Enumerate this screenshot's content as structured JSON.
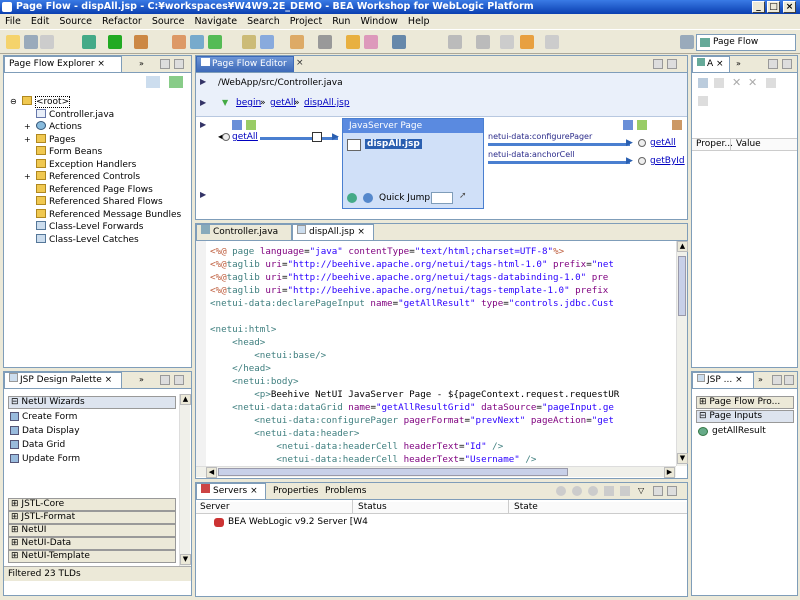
{
  "window": {
    "title": "Page Flow - dispAll.jsp - C:¥workspaces¥W4W9.2E_DEMO - BEA Workshop for WebLogic Platform",
    "min": "_",
    "max": "□",
    "close": "×"
  },
  "menu": [
    "File",
    "Edit",
    "Source",
    "Refactor",
    "Source",
    "Navigate",
    "Search",
    "Project",
    "Run",
    "Window",
    "Help"
  ],
  "perspective": {
    "label": "Page Flow"
  },
  "explorer": {
    "tab": "Page Flow Explorer",
    "items": [
      {
        "label": "<root>",
        "indent": 0,
        "exp": "⊖",
        "icon": "folder"
      },
      {
        "label": "Controller.java",
        "indent": 1,
        "exp": "",
        "icon": "java"
      },
      {
        "label": "Actions",
        "indent": 1,
        "exp": "+",
        "icon": "action"
      },
      {
        "label": "Pages",
        "indent": 1,
        "exp": "+",
        "icon": "folder"
      },
      {
        "label": "Form Beans",
        "indent": 1,
        "exp": "",
        "icon": "folder"
      },
      {
        "label": "Exception Handlers",
        "indent": 1,
        "exp": "",
        "icon": "folder"
      },
      {
        "label": "Referenced Controls",
        "indent": 1,
        "exp": "+",
        "icon": "folder"
      },
      {
        "label": "Referenced Page Flows",
        "indent": 1,
        "exp": "",
        "icon": "folder"
      },
      {
        "label": "Referenced Shared Flows",
        "indent": 1,
        "exp": "",
        "icon": "folder"
      },
      {
        "label": "Referenced Message Bundles",
        "indent": 1,
        "exp": "",
        "icon": "folder"
      },
      {
        "label": "Class-Level Forwards",
        "indent": 1,
        "exp": "",
        "icon": "fwd"
      },
      {
        "label": "Class-Level Catches",
        "indent": 1,
        "exp": "",
        "icon": "fwd"
      }
    ]
  },
  "editor": {
    "tab": "Page Flow Editor",
    "path": "/WebApp/src/Controller.java",
    "crumbs": [
      "begin",
      "getAll",
      "dispAll.jsp"
    ],
    "left_action": "getAll",
    "page_title": "JavaServer Page",
    "page_name": "dispAll.jsp",
    "quick_jump": "Quick Jump",
    "right_rows": [
      {
        "tag": "netui-data:configurePager",
        "action": "getAll"
      },
      {
        "tag": "netui-data:anchorCell",
        "action": "getById"
      }
    ]
  },
  "code_tabs": [
    "Controller.java",
    "dispAll.jsp"
  ],
  "code": [
    [
      [
        "dir",
        "<%@ "
      ],
      [
        "kw",
        "page "
      ],
      [
        "att",
        "language"
      ],
      [
        "",
        "="
      ],
      [
        "str",
        "\"java\" "
      ],
      [
        "att",
        "contentType"
      ],
      [
        "",
        "="
      ],
      [
        "str",
        "\"text/html;charset=UTF-8\""
      ],
      [
        "dir",
        "%>"
      ]
    ],
    [
      [
        "dir",
        "<%@"
      ],
      [
        "kw",
        "taglib "
      ],
      [
        "att",
        "uri"
      ],
      [
        "",
        "="
      ],
      [
        "str",
        "\"http://beehive.apache.org/netui/tags-html-1.0\" "
      ],
      [
        "att",
        "prefix"
      ],
      [
        "",
        "="
      ],
      [
        "str",
        "\"net"
      ]
    ],
    [
      [
        "dir",
        "<%@"
      ],
      [
        "kw",
        "taglib "
      ],
      [
        "att",
        "uri"
      ],
      [
        "",
        "="
      ],
      [
        "str",
        "\"http://beehive.apache.org/netui/tags-databinding-1.0\" "
      ],
      [
        "att",
        "pre"
      ]
    ],
    [
      [
        "dir",
        "<%@"
      ],
      [
        "kw",
        "taglib "
      ],
      [
        "att",
        "uri"
      ],
      [
        "",
        "="
      ],
      [
        "str",
        "\"http://beehive.apache.org/netui/tags-template-1.0\" "
      ],
      [
        "att",
        "prefix"
      ]
    ],
    [
      [
        "kw",
        "<netui-data:declarePageInput "
      ],
      [
        "att",
        "name"
      ],
      [
        "",
        "="
      ],
      [
        "str",
        "\"getAllResult\" "
      ],
      [
        "att",
        "type"
      ],
      [
        "",
        "="
      ],
      [
        "str",
        "\"controls.jdbc.Cust"
      ]
    ],
    [
      [
        "",
        ""
      ]
    ],
    [
      [
        "kw",
        "<netui:html>"
      ]
    ],
    [
      [
        "kw",
        "    <head>"
      ]
    ],
    [
      [
        "kw",
        "        <netui:base/>"
      ]
    ],
    [
      [
        "kw",
        "    </head>"
      ]
    ],
    [
      [
        "kw",
        "    <netui:body>"
      ]
    ],
    [
      [
        "kw",
        "        <p>"
      ],
      [
        "",
        "Beehive NetUI JavaServer Page - ${pageContext.request.requestUR"
      ]
    ],
    [
      [
        "kw",
        "    <netui-data:dataGrid "
      ],
      [
        "att",
        "name"
      ],
      [
        "",
        "="
      ],
      [
        "str",
        "\"getAllResultGrid\" "
      ],
      [
        "att",
        "dataSource"
      ],
      [
        "",
        "="
      ],
      [
        "str",
        "\"pageInput.ge"
      ]
    ],
    [
      [
        "kw",
        "        <netui-data:configurePager "
      ],
      [
        "att",
        "pagerFormat"
      ],
      [
        "",
        "="
      ],
      [
        "str",
        "\"prevNext\" "
      ],
      [
        "att",
        "pageAction"
      ],
      [
        "",
        "="
      ],
      [
        "str",
        "\"get"
      ]
    ],
    [
      [
        "kw",
        "        <netui-data:header>"
      ]
    ],
    [
      [
        "kw",
        "            <netui-data:headerCell "
      ],
      [
        "att",
        "headerText"
      ],
      [
        "",
        "="
      ],
      [
        "str",
        "\"Id\" "
      ],
      [
        "kw",
        "/>"
      ]
    ],
    [
      [
        "kw",
        "            <netui-data:headerCell "
      ],
      [
        "att",
        "headerText"
      ],
      [
        "",
        "="
      ],
      [
        "str",
        "\"Username\" "
      ],
      [
        "kw",
        "/>"
      ]
    ]
  ],
  "outline": {
    "tab": "A",
    "cols": [
      "Proper...",
      "Value"
    ]
  },
  "palette": {
    "tab": "JSP Design Palette",
    "wizard_header": "NetUI Wizards",
    "wizards": [
      "Create Form",
      "Data Display",
      "Data Grid",
      "Update Form"
    ],
    "categories": [
      "JSTL-Core",
      "JSTL-Format",
      "NetUI",
      "NetUI-Data",
      "NetUI-Template"
    ],
    "status": "Filtered 23 TLDs"
  },
  "jsp_panel": {
    "tab": "JSP ...",
    "items": [
      "Page Flow Pro...",
      "Page Inputs",
      "getAllResult"
    ]
  },
  "servers": {
    "tabs": [
      "Servers",
      "Properties",
      "Problems"
    ],
    "cols": [
      "Server",
      "Status",
      "State"
    ],
    "rows": [
      {
        "server": "BEA WebLogic v9.2 Server [W4",
        "status": "",
        "state": ""
      }
    ]
  }
}
